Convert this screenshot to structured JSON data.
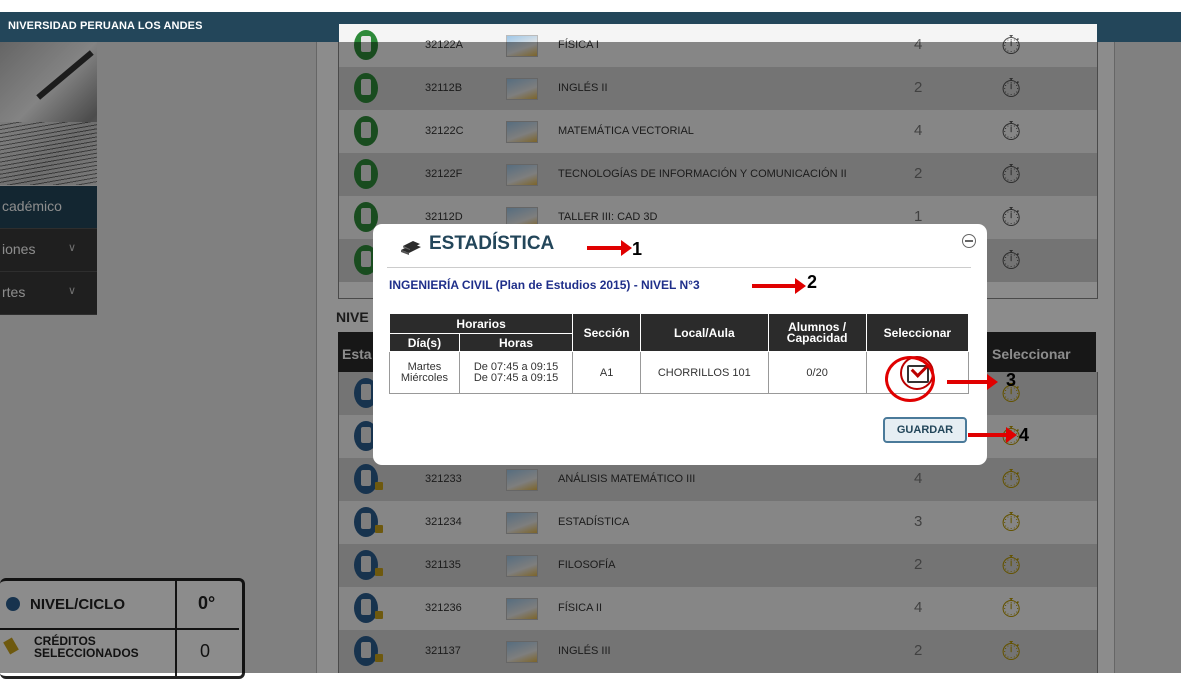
{
  "header": {
    "brand": "NIVERSIDAD PERUANA LOS ANDES"
  },
  "sidebar": {
    "items": [
      {
        "label": "cadémico"
      },
      {
        "label": "iones"
      },
      {
        "label": "rtes"
      }
    ]
  },
  "background": {
    "rows_top": [
      {
        "code": "32122A",
        "name": "FÍSICA I",
        "credits": "4",
        "state": "green"
      },
      {
        "code": "32112B",
        "name": "INGLÉS II",
        "credits": "2",
        "state": "green"
      },
      {
        "code": "32122C",
        "name": "MATEMÁTICA VECTORIAL",
        "credits": "4",
        "state": "green"
      },
      {
        "code": "32122F",
        "name": "TECNOLOGÍAS DE INFORMACIÓN Y COMUNICACIÓN II",
        "credits": "2",
        "state": "green"
      },
      {
        "code": "32112D",
        "name": "TALLER III: CAD 3D",
        "credits": "1",
        "state": "green"
      }
    ],
    "nivel_heading": "NIVE",
    "table_header": {
      "left": "Esta",
      "right": "Seleccionar"
    },
    "rows_bottom": [
      {
        "code": "321233",
        "name": "ANÁLISIS MATEMÁTICO III",
        "credits": "4"
      },
      {
        "code": "321234",
        "name": "ESTADÍSTICA",
        "credits": "3"
      },
      {
        "code": "321135",
        "name": "FILOSOFÍA",
        "credits": "2"
      },
      {
        "code": "321236",
        "name": "FÍSICA II",
        "credits": "4"
      },
      {
        "code": "321137",
        "name": "INGLÉS III",
        "credits": "2"
      }
    ],
    "summary": {
      "nivel_label": "NIVEL/CICLO",
      "nivel_value": "0°",
      "creditos_label": "CRÉDITOS SELECCIONADOS",
      "creditos_value": "0"
    }
  },
  "modal": {
    "title": "ESTADÍSTICA",
    "subtitle": "INGENIERÍA CIVIL (Plan de Estudios 2015) - NIVEL N°3",
    "table": {
      "group_header": "Horarios",
      "headers": {
        "dias": "Día(s)",
        "horas": "Horas",
        "seccion": "Sección",
        "local": "Local/Aula",
        "alumnos": "Alumnos / Capacidad",
        "seleccionar": "Seleccionar"
      },
      "rows": [
        {
          "dias": [
            "Martes",
            "Miércoles"
          ],
          "horas": [
            "De 07:45 a 09:15",
            "De 07:45 a 09:15"
          ],
          "seccion": "A1",
          "local": "CHORRILLOS 101",
          "alumnos": "0/20"
        }
      ]
    },
    "save_label": "GUARDAR"
  },
  "annotations": [
    "1",
    "2",
    "3",
    "4"
  ],
  "colors": {
    "brand": "#23465a",
    "accent_red": "#e00000",
    "subtitle_blue": "#1f2f8a"
  }
}
